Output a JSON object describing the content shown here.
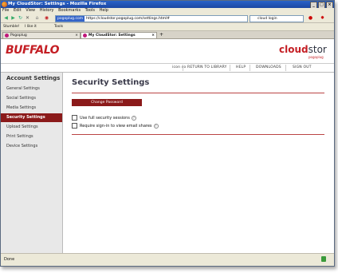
{
  "window": {
    "title": "My CloudStor: Settings - Mozilla Firefox"
  },
  "menu": [
    "File",
    "Edit",
    "View",
    "History",
    "Bookmarks",
    "Tools",
    "Help"
  ],
  "nav": {
    "site_badge": "pogoplug.com",
    "url": "https://cloudstor.pogoplug.com/settings.html#",
    "search_value": "cloud login"
  },
  "bookmarks": {
    "item1": "Stumble!",
    "item2": "I like it",
    "item3": "Tools"
  },
  "tabs": [
    {
      "label": "Pogoplug"
    },
    {
      "label": "My CloudStor: Settings"
    }
  ],
  "header": {
    "brand": "BUFFALO",
    "logo_cloud": "cloud",
    "logo_stor": "stor",
    "logo_sub": "pogoplug"
  },
  "topnav": {
    "user": "icon co",
    "return": "RETURN TO LIBRARY",
    "help": "HELP",
    "downloads": "DOWNLOADS",
    "signout": "SIGN OUT"
  },
  "sidebar": {
    "title": "Account Settings",
    "items": [
      {
        "label": "General Settings"
      },
      {
        "label": "Social Settings"
      },
      {
        "label": "Media Settings"
      },
      {
        "label": "Security Settings"
      },
      {
        "label": "Upload Settings"
      },
      {
        "label": "Print Settings"
      },
      {
        "label": "Device Settings"
      }
    ],
    "active_index": 3
  },
  "main": {
    "title": "Security Settings",
    "change_password": "Change Password",
    "opt1": "Use full security sessions",
    "opt2": "Require sign-in to view email shares"
  },
  "status": {
    "text": "Done"
  },
  "colors": {
    "accent": "#8b1a1a",
    "brand_red": "#c41e24"
  }
}
